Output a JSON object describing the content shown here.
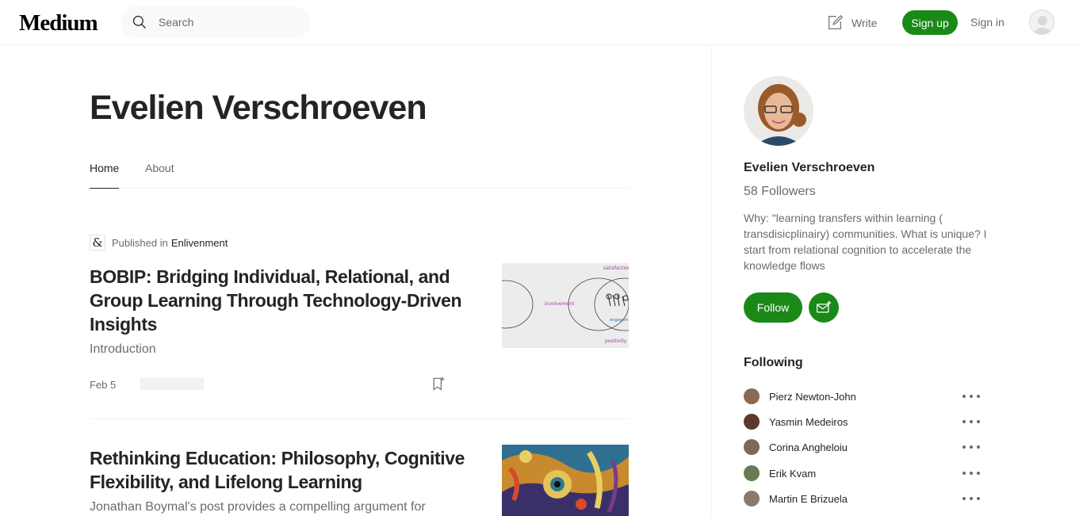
{
  "header": {
    "logo": "Medium",
    "search_placeholder": "Search",
    "write_label": "Write",
    "signup_label": "Sign up",
    "signin_label": "Sign in"
  },
  "profile": {
    "name": "Evelien Verschroeven",
    "tabs": [
      {
        "label": "Home",
        "active": true
      },
      {
        "label": "About",
        "active": false
      }
    ]
  },
  "posts": [
    {
      "published_in_label": "Published in",
      "publication": "Enlivenment",
      "publication_icon": "&",
      "title": "BOBIP: Bridging Individual, Relational, and Group Learning Through Technology-Driven Insights",
      "subtitle": "Introduction",
      "date": "Feb 5",
      "thumbnail_words": [
        "satisfaction",
        "involvement",
        "engagement",
        "positivity"
      ]
    },
    {
      "title": "Rethinking Education: Philosophy, Cognitive Flexibility, and Lifelong Learning",
      "subtitle": "Jonathan Boymal's post provides a compelling argument for"
    }
  ],
  "sidebar": {
    "name": "Evelien Verschroeven",
    "followers": "58 Followers",
    "bio": "Why: \"learning transfers within learning ( transdisicplinairy) communities. What is unique? I start from relational cognition to accelerate the knowledge flows",
    "follow_label": "Follow",
    "following_title": "Following",
    "following": [
      {
        "name": "Pierz Newton-John",
        "color": "#8a6a55"
      },
      {
        "name": "Yasmin Medeiros",
        "color": "#5a3b2e"
      },
      {
        "name": "Corina Angheloiu",
        "color": "#7a6a5a"
      },
      {
        "name": "Erik Kvam",
        "color": "#6a7a55"
      },
      {
        "name": "Martin E Brizuela",
        "color": "#8a7a6a"
      }
    ]
  },
  "colors": {
    "accent": "#1a8917",
    "text": "#242424",
    "muted": "#6b6b6b"
  }
}
